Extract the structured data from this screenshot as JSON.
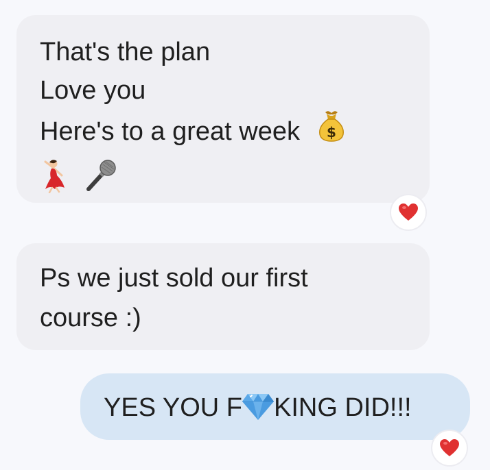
{
  "messages": [
    {
      "direction": "incoming",
      "lines": [
        "That's the plan",
        "Love you",
        "Here's to a great week"
      ],
      "emojis": [
        "money-bag",
        "dancer",
        "microphone"
      ],
      "reaction": "red-heart"
    },
    {
      "direction": "incoming",
      "lines": [
        "Ps we just sold our first",
        "course :)"
      ],
      "reaction": null
    },
    {
      "direction": "outgoing",
      "text_before": "YES YOU F",
      "inline_emoji": "gem-stone",
      "text_after": "KING DID!!!",
      "reaction": "red-heart"
    }
  ],
  "colors": {
    "background": "#f7f8fc",
    "incoming_bubble": "#efeff3",
    "outgoing_bubble": "#d7e6f5",
    "heart": "#e03131",
    "text": "#1f1f1f"
  }
}
